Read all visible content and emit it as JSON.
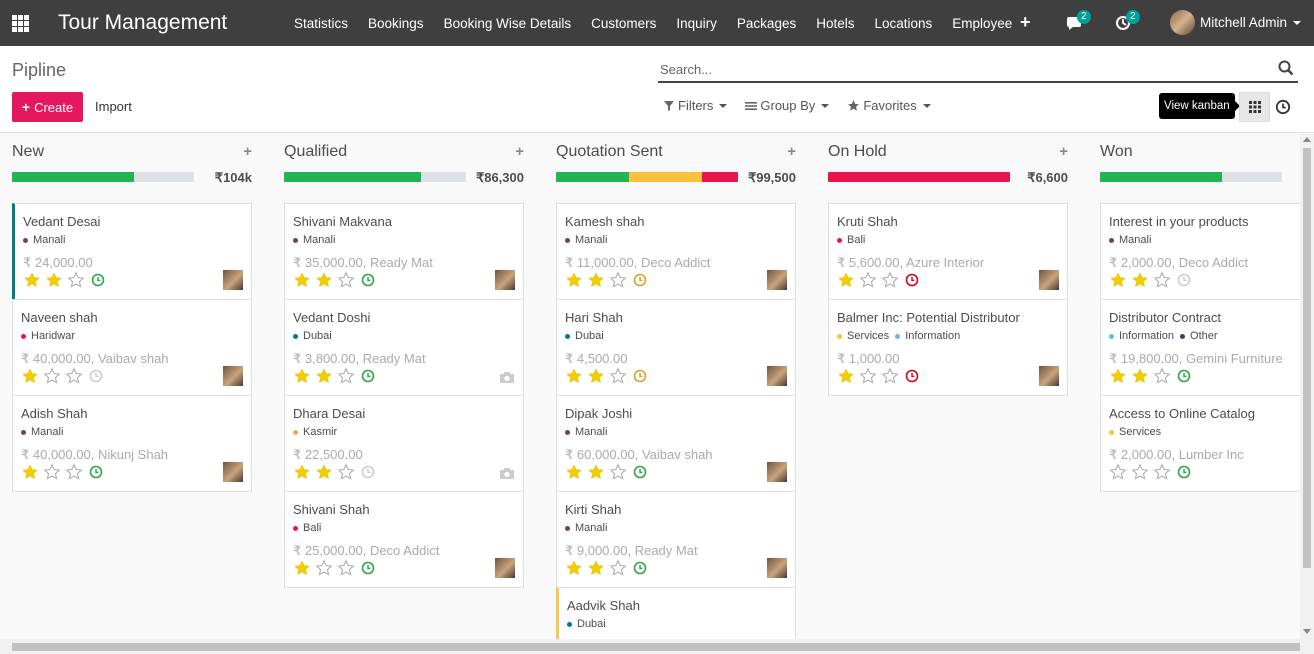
{
  "navbar": {
    "brand": "Tour Management",
    "menu": [
      "Statistics",
      "Bookings",
      "Booking Wise Details",
      "Customers",
      "Inquiry",
      "Packages",
      "Hotels",
      "Locations",
      "Employee"
    ],
    "messages_count": "2",
    "activities_count": "2",
    "user_name": "Mitchell Admin"
  },
  "control": {
    "breadcrumb": "Pipline",
    "create_label": "Create",
    "import_label": "Import",
    "search_placeholder": "Search...",
    "filters_label": "Filters",
    "groupby_label": "Group By",
    "favorites_label": "Favorites",
    "tooltip": "View kanban"
  },
  "colors": {
    "green": "#21b354",
    "yellow": "#fcc13b",
    "red": "#e8144c",
    "grey": "#dee2e6",
    "star_on": "#f3cc00",
    "star_off": "#b0b0b0",
    "clock_green": "#28a745",
    "clock_orange": "#d89f27",
    "clock_red": "#d0021b",
    "clock_grey": "#cccccc",
    "accent_teal": "#017e84",
    "accent_yellow": "#f6cb4f",
    "create_button": "#e4185f"
  },
  "columns": [
    {
      "title": "New",
      "total": "₹104k",
      "progress": [
        {
          "color": "green",
          "fraction": 0.67
        }
      ],
      "cards": [
        {
          "title": "Vedant Desai",
          "tags": [
            {
              "label": "Manali",
              "color": "#7d3c5a"
            }
          ],
          "meta": "₹ 24,000.00",
          "stars": 2,
          "activity": "green",
          "avatar": true,
          "accent": "#017e84"
        },
        {
          "title": "Naveen shah",
          "tags": [
            {
              "label": "Haridwar",
              "color": "#e8144c"
            }
          ],
          "meta": "₹ 40,000.00, Vaibav shah",
          "stars": 1,
          "activity": "grey",
          "avatar": true
        },
        {
          "title": "Adish Shah",
          "tags": [
            {
              "label": "Manali",
              "color": "#7d3c5a"
            }
          ],
          "meta": "₹ 40,000.00, Nikunj Shah",
          "stars": 1,
          "activity": "green",
          "avatar": true
        }
      ]
    },
    {
      "title": "Qualified",
      "total": "₹86,300",
      "progress": [
        {
          "color": "green",
          "fraction": 0.75
        }
      ],
      "cards": [
        {
          "title": "Shivani Makvana",
          "tags": [
            {
              "label": "Manali",
              "color": "#7d3c5a"
            }
          ],
          "meta": "₹ 35,000.00, Ready Mat",
          "stars": 2,
          "activity": "green",
          "avatar": true
        },
        {
          "title": "Vedant Doshi",
          "tags": [
            {
              "label": "Dubai",
              "color": "#017e84"
            }
          ],
          "meta": "₹ 3,800.00, Ready Mat",
          "stars": 2,
          "activity": "green",
          "avatar": false
        },
        {
          "title": "Dhara Desai",
          "tags": [
            {
              "label": "Kasmir",
              "color": "#f4a460"
            }
          ],
          "meta": "₹ 22,500.00",
          "stars": 2,
          "activity": "grey",
          "avatar": false
        },
        {
          "title": "Shivani Shah",
          "tags": [
            {
              "label": "Bali",
              "color": "#e8144c"
            }
          ],
          "meta": "₹ 25,000.00, Deco Addict",
          "stars": 1,
          "activity": "green",
          "avatar": true
        }
      ]
    },
    {
      "title": "Quotation Sent",
      "total": "₹99,500",
      "progress": [
        {
          "color": "green",
          "fraction": 0.4
        },
        {
          "color": "yellow",
          "fraction": 0.4
        },
        {
          "color": "red",
          "fraction": 0.2
        }
      ],
      "cards": [
        {
          "title": "Kamesh shah",
          "tags": [
            {
              "label": "Manali",
              "color": "#7d3c5a"
            }
          ],
          "meta": "₹ 11,000.00, Deco Addict",
          "stars": 2,
          "activity": "orange",
          "avatar": true
        },
        {
          "title": "Hari Shah",
          "tags": [
            {
              "label": "Dubai",
              "color": "#017e84"
            }
          ],
          "meta": "₹ 4,500.00",
          "stars": 2,
          "activity": "orange",
          "avatar": true
        },
        {
          "title": "Dipak Joshi",
          "tags": [
            {
              "label": "Manali",
              "color": "#7d3c5a"
            }
          ],
          "meta": "₹ 60,000.00, Vaibav shah",
          "stars": 2,
          "activity": "green",
          "avatar": true
        },
        {
          "title": "Kirti Shah",
          "tags": [
            {
              "label": "Manali",
              "color": "#7d3c5a"
            }
          ],
          "meta": "₹ 9,000.00, Ready Mat",
          "stars": 2,
          "activity": "green",
          "avatar": true
        },
        {
          "title": "Aadvik Shah",
          "tags": [
            {
              "label": "Dubai",
              "color": "#017e84"
            }
          ],
          "meta": "",
          "stars": 0,
          "activity": "",
          "avatar": false,
          "accent": "#f6cb4f"
        }
      ]
    },
    {
      "title": "On Hold",
      "total": "₹6,600",
      "progress": [
        {
          "color": "red",
          "fraction": 1.0
        }
      ],
      "cards": [
        {
          "title": "Kruti Shah",
          "tags": [
            {
              "label": "Bali",
              "color": "#e8144c"
            }
          ],
          "meta": "₹ 5,600.00, Azure Interior",
          "stars": 1,
          "activity": "red",
          "avatar": true
        },
        {
          "title": "Balmer Inc: Potential Distributor",
          "tags": [
            {
              "label": "Services",
              "color": "#fcc13b"
            },
            {
              "label": "Information",
              "color": "#5bc0de"
            }
          ],
          "meta": "₹ 1,000.00",
          "stars": 1,
          "activity": "red",
          "avatar": true
        }
      ]
    },
    {
      "title": "Won",
      "total": "",
      "progress": [
        {
          "color": "green",
          "fraction": 0.67
        }
      ],
      "cards": [
        {
          "title": "Interest in your products",
          "tags": [
            {
              "label": "Manali",
              "color": "#7d3c5a"
            }
          ],
          "meta": "₹ 2,000.00, Deco Addict",
          "stars": 2,
          "activity": "grey",
          "avatar": false
        },
        {
          "title": "Distributor Contract",
          "tags": [
            {
              "label": "Information",
              "color": "#5bc0de"
            },
            {
              "label": "Other",
              "color": "#3f3f5f"
            }
          ],
          "meta": "₹ 19,800.00, Gemini Furniture",
          "stars": 2,
          "activity": "green",
          "avatar": false
        },
        {
          "title": "Access to Online Catalog",
          "tags": [
            {
              "label": "Services",
              "color": "#fcc13b"
            }
          ],
          "meta": "₹ 2,000.00, Lumber Inc",
          "stars": 0,
          "activity": "green",
          "avatar": false
        }
      ]
    }
  ]
}
